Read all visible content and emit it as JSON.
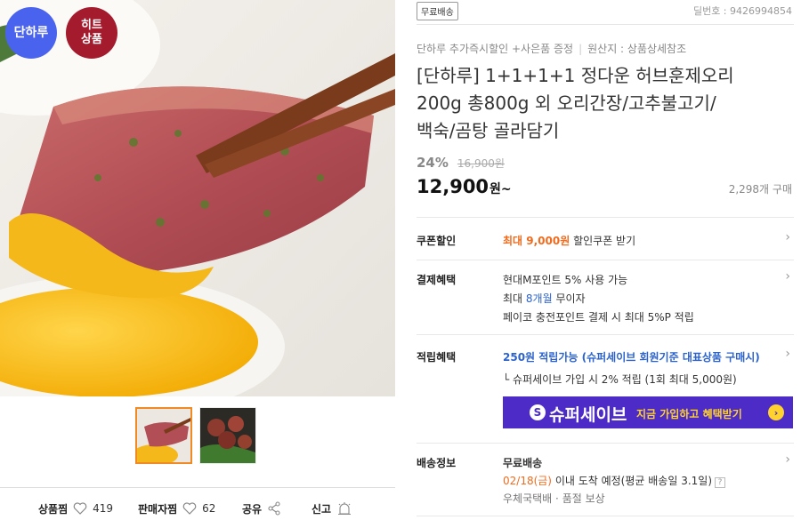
{
  "badges": {
    "danharu": "단하루",
    "hit_line1": "히트",
    "hit_line2": "상품"
  },
  "thumbnails": [
    "thumbnail-smoked-duck",
    "thumbnail-duck-bulgogi"
  ],
  "actions": {
    "like_label": "상품찜",
    "like_count": "419",
    "seller_label": "판매자찜",
    "seller_count": "62",
    "share_label": "공유",
    "report_label": "신고"
  },
  "product": {
    "free_ship_tag": "무료배송",
    "id_text": "딜번호 : 9426994854",
    "subline_1": "단하루 추가즉시할인 +사은품 증정",
    "subline_2": "원산지 : 상품상세참조",
    "title_lines": [
      "[단하루] 1+1+1+1 정다운 허브훈제오리",
      "200g 총800g 외 오리간장/고추불고기/",
      "백숙/곰탕 골라담기"
    ],
    "discount": "24%",
    "original_price": "16,900원",
    "sale_price": "12,900",
    "sale_unit": "원~",
    "sold_count": "2,298개 구매"
  },
  "coupon": {
    "label": "쿠폰할인",
    "highlight": "최대 9,000원",
    "rest": " 할인쿠폰 받기"
  },
  "payment": {
    "label": "결제혜택",
    "line1": "현대M포인트 5% 사용 가능",
    "line2_a": "최대 ",
    "line2_b": "8개월",
    "line2_c": " 무이자",
    "line3": "페이코 충전포인트 결제 시 최대 5%P 적립"
  },
  "points": {
    "label": "적립혜택",
    "line1_a": "250원 적립가능",
    "line1_b": " (슈퍼세이브 회원기준 대표상품 구매시)",
    "line2": "└ 슈퍼세이브 가입 시 2% 적립 (1회 최대 5,000원)",
    "banner_logo": "S",
    "banner_name": "슈퍼세이브",
    "banner_cta": "지금 가입하고 혜택받기",
    "banner_arrow": "›"
  },
  "shipping": {
    "label": "배송정보",
    "line1": "무료배송",
    "line2_date": "02/18(금)",
    "line2_rest": " 이내 도착 예정(평균 배송일 3.1일)",
    "line2_help": "?",
    "line3_a": "우체국택배",
    "line3_sep": "·",
    "line3_b": "품절 보상"
  },
  "chevron": "›",
  "colors": {
    "accent_orange": "#f06b1e",
    "link_blue": "#2b62cc",
    "supersave_purple": "#4c2bc7",
    "badge_blue": "#4a63ee",
    "badge_red": "#a31b2c"
  }
}
